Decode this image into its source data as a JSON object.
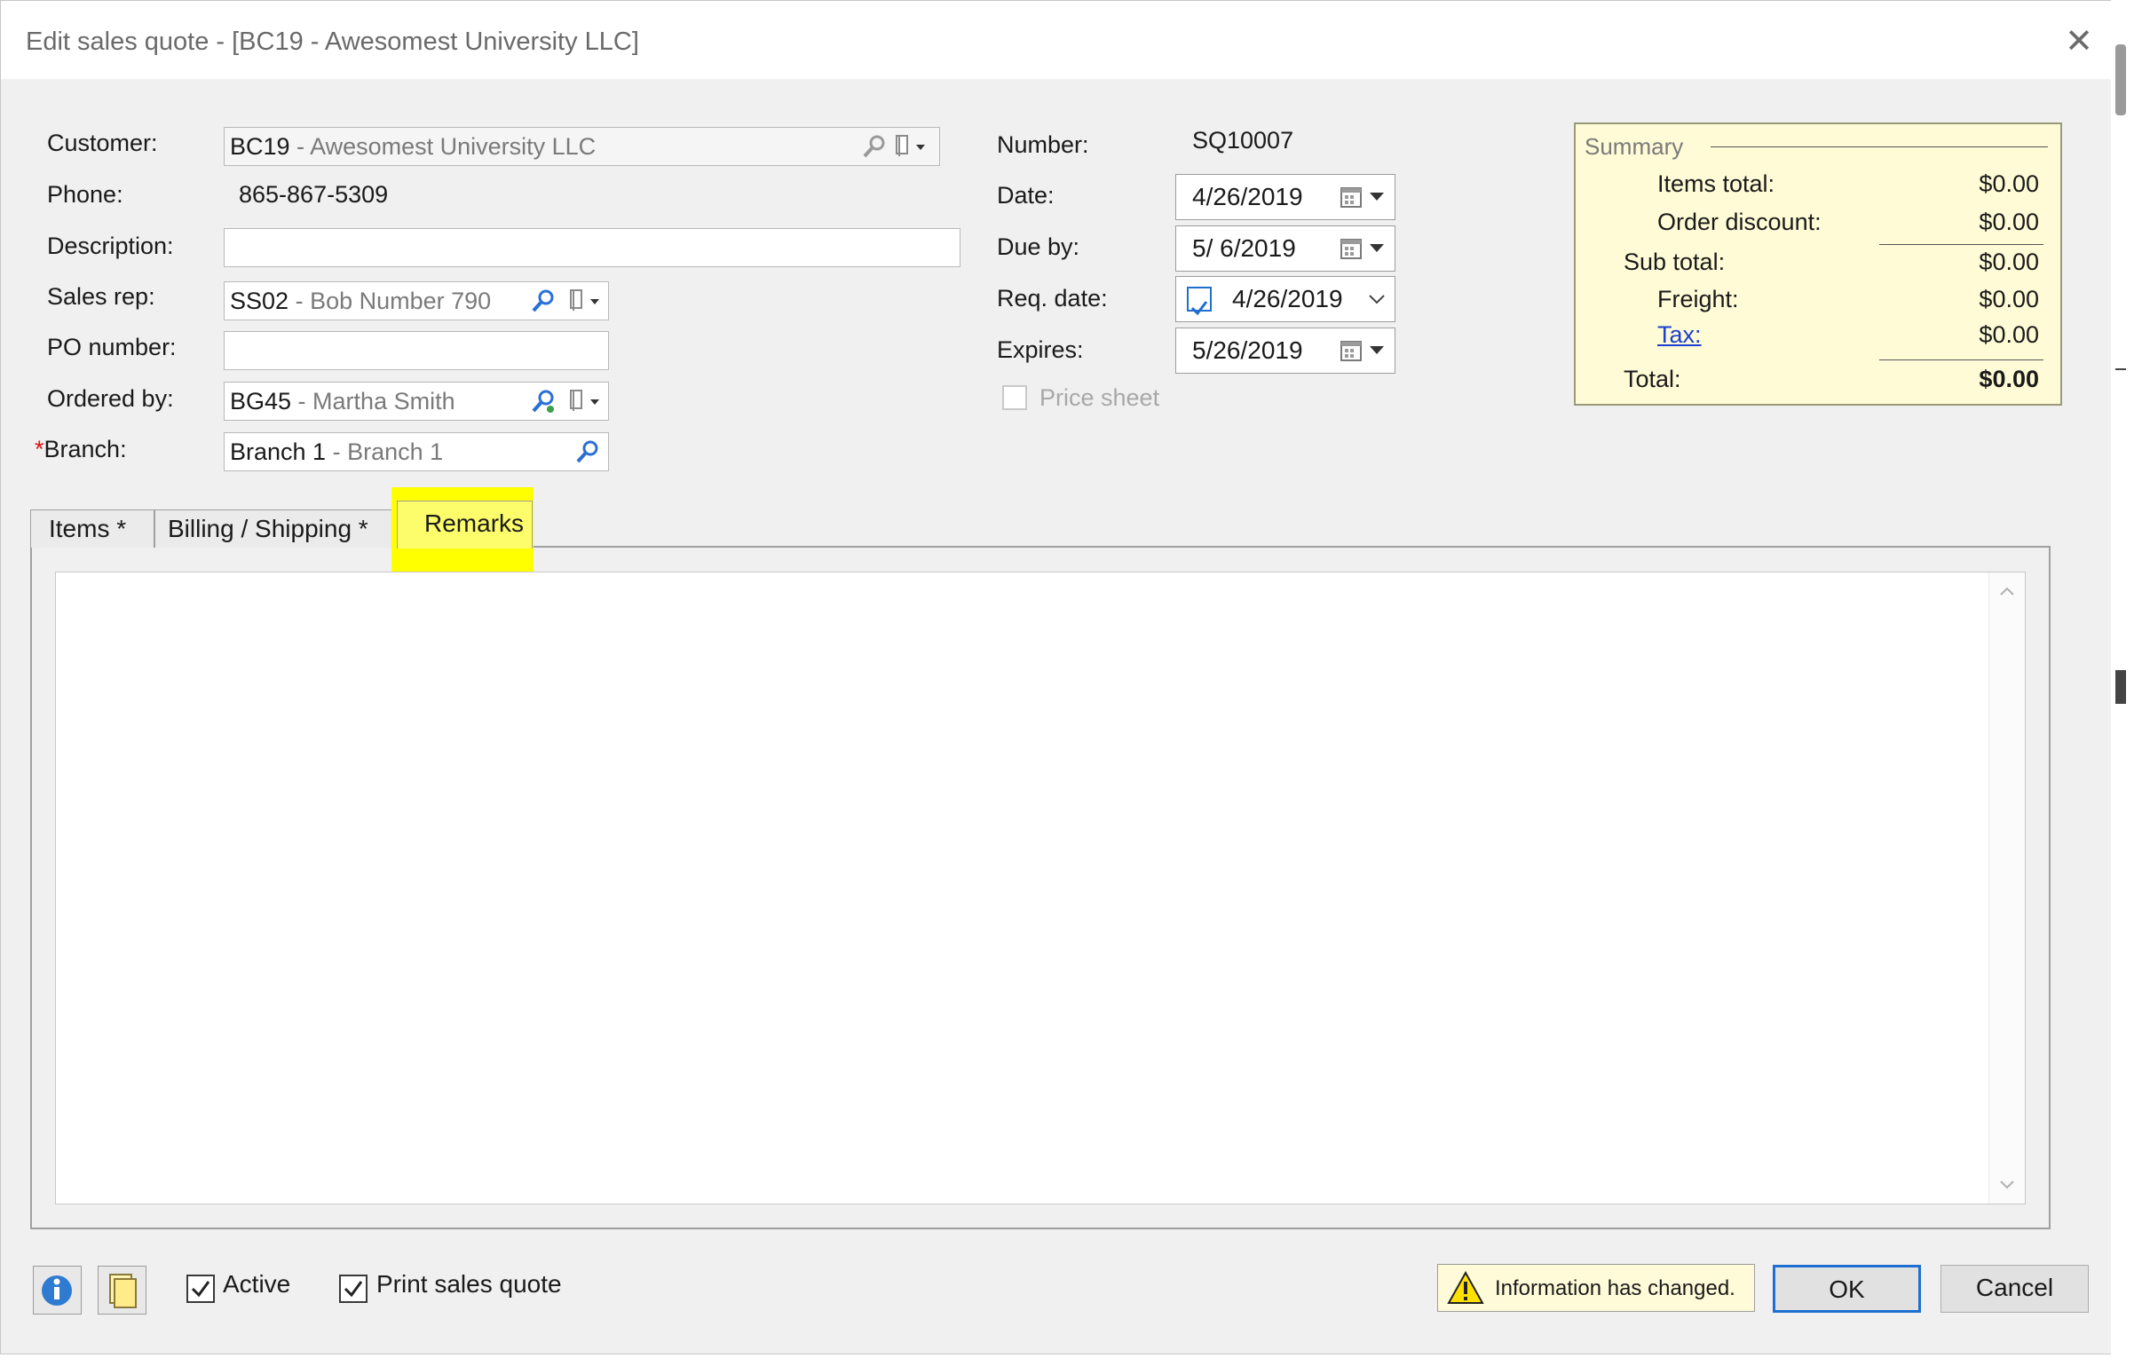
{
  "window": {
    "title": "Edit sales quote - [BC19 - Awesomest University LLC]",
    "close_label": "✕"
  },
  "customer": {
    "label": "Customer:",
    "code": "BC19",
    "sep": " - ",
    "desc": "Awesomest University LLC"
  },
  "phone": {
    "label": "Phone:",
    "value": "865-867-5309"
  },
  "description": {
    "label": "Description:",
    "value": ""
  },
  "sales_rep": {
    "label": "Sales rep:",
    "code": "SS02",
    "sep": " - ",
    "desc": "Bob Number 790"
  },
  "po_number": {
    "label": "PO number:",
    "value": ""
  },
  "ordered_by": {
    "label": "Ordered by:",
    "code": "BG45",
    "sep": " - ",
    "desc": "Martha Smith"
  },
  "branch": {
    "label": "Branch:",
    "required_mark": "*",
    "code": "Branch 1",
    "sep": " - ",
    "desc": "Branch 1"
  },
  "number": {
    "label": "Number:",
    "value": "SQ10007"
  },
  "date": {
    "label": "Date:",
    "value": "4/26/2019"
  },
  "due_by": {
    "label": "Due by:",
    "value": "5/ 6/2019"
  },
  "req_date": {
    "label": "Req. date:",
    "value": "4/26/2019",
    "checked": true
  },
  "expires": {
    "label": "Expires:",
    "value": "5/26/2019"
  },
  "price_sheet": {
    "label": "Price sheet",
    "checked": false,
    "enabled": false
  },
  "summary": {
    "title": "Summary",
    "items_total": {
      "label": "Items total:",
      "value": "$0.00"
    },
    "order_discount": {
      "label": "Order discount:",
      "value": "$0.00"
    },
    "sub_total": {
      "label": "Sub total:",
      "value": "$0.00"
    },
    "freight": {
      "label": "Freight:",
      "value": "$0.00"
    },
    "tax": {
      "label": "Tax:",
      "value": "$0.00"
    },
    "total": {
      "label": "Total:",
      "value": "$0.00"
    }
  },
  "tabs": [
    {
      "label": "Items *",
      "active": false
    },
    {
      "label": "Billing / Shipping  *",
      "active": false
    },
    {
      "label": "Remarks",
      "active": true
    }
  ],
  "remarks": {
    "value": ""
  },
  "footer": {
    "active": {
      "label": "Active",
      "checked": true
    },
    "print_quote": {
      "label": "Print sales quote",
      "checked": true
    },
    "warning": "Information has changed.",
    "ok_label": "OK",
    "cancel_label": "Cancel"
  },
  "colors": {
    "highlight": "#ffff00",
    "link": "#1a3fd1",
    "accent": "#1f6fd0",
    "summary_bg": "#fffbd6"
  },
  "icons": [
    "close-icon",
    "search-icon",
    "bookmark-dropdown-icon",
    "calendar-icon",
    "dropdown-arrow-icon",
    "checkmark-icon",
    "info-icon",
    "notes-icon",
    "warning-icon",
    "scroll-up-icon",
    "scroll-down-icon"
  ]
}
